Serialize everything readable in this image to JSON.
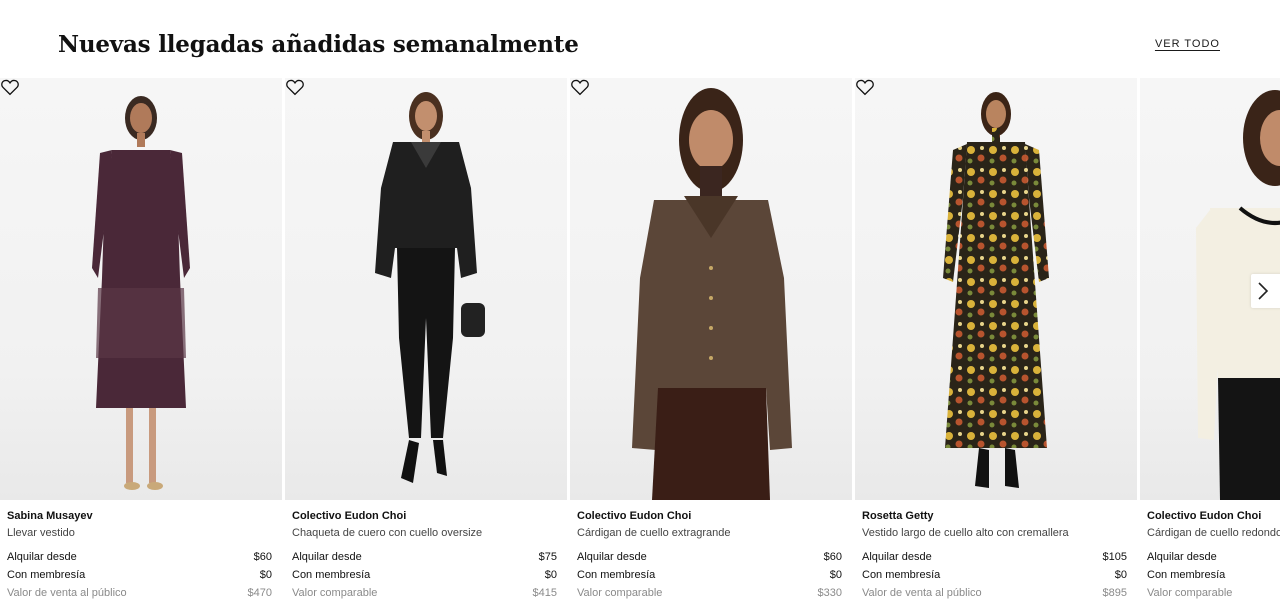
{
  "header": {
    "title": "Nuevas llegadas añadidas semanalmente",
    "view_all": "VER TODO"
  },
  "icons": {
    "favorite": "heart-outline-icon",
    "next": "chevron-right-icon"
  },
  "products": [
    {
      "designer": "Sabina Musayev",
      "name": "Llevar vestido",
      "rent_label": "Alquilar desde",
      "rent_price": "$60",
      "member_label": "Con membresía",
      "member_price": "$0",
      "retail_label": "Valor de venta al público",
      "retail_price": "$470"
    },
    {
      "designer": "Colectivo Eudon Choi",
      "name": "Chaqueta de cuero con cuello oversize",
      "rent_label": "Alquilar desde",
      "rent_price": "$75",
      "member_label": "Con membresía",
      "member_price": "$0",
      "retail_label": "Valor comparable",
      "retail_price": "$415"
    },
    {
      "designer": "Colectivo Eudon Choi",
      "name": "Cárdigan de cuello extragrande",
      "rent_label": "Alquilar desde",
      "rent_price": "$60",
      "member_label": "Con membresía",
      "member_price": "$0",
      "retail_label": "Valor comparable",
      "retail_price": "$330"
    },
    {
      "designer": "Rosetta Getty",
      "name": "Vestido largo de cuello alto con cremallera",
      "rent_label": "Alquilar desde",
      "rent_price": "$105",
      "member_label": "Con membresía",
      "member_price": "$0",
      "retail_label": "Valor de venta al público",
      "retail_price": "$895"
    },
    {
      "designer": "Colectivo Eudon Choi",
      "name": "Cárdigan de cuello redondo",
      "rent_label": "Alquilar desde",
      "rent_price": "",
      "member_label": "Con membresía",
      "member_price": "",
      "retail_label": "Valor comparable",
      "retail_price": ""
    }
  ]
}
